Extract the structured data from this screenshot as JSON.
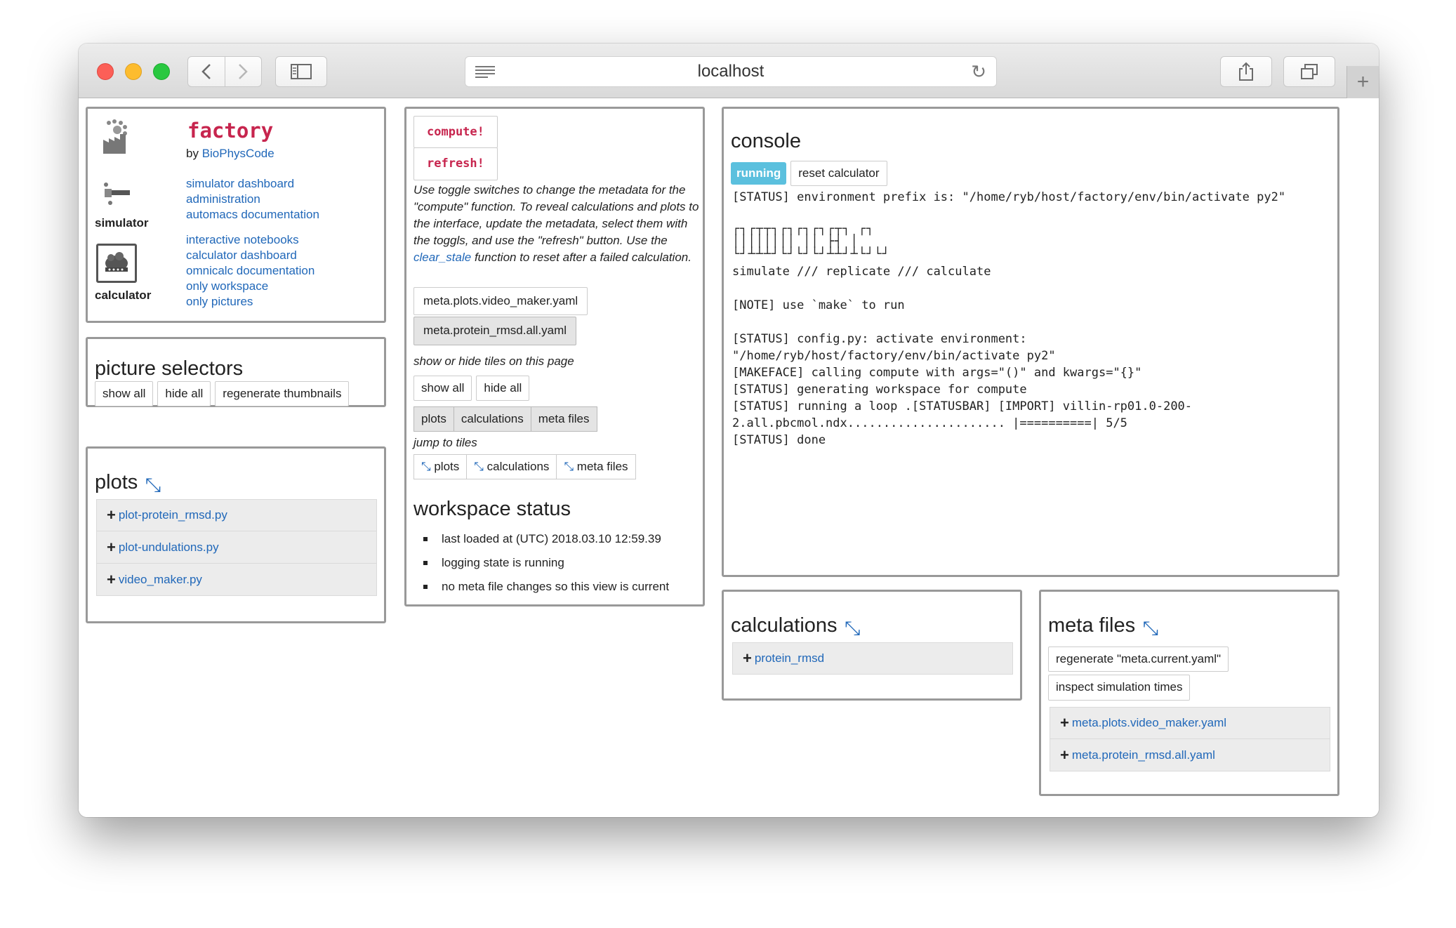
{
  "browser": {
    "url": "localhost",
    "back_icon": "chevron-left-icon",
    "forward_icon": "chevron-right-icon",
    "sidebar_icon": "sidebar-icon",
    "reader_icon": "reader-lines-icon",
    "reload_icon": "reload-icon",
    "share_icon": "share-icon",
    "tabs_icon": "tabs-icon",
    "new_tab_icon": "plus-icon"
  },
  "brand": {
    "name": "factory",
    "by_prefix": "by ",
    "by_link": "BioPhysCode",
    "simulator_label": "simulator",
    "calculator_label": "calculator",
    "simulator_links": [
      "simulator dashboard",
      "administration",
      "automacs documentation"
    ],
    "calculator_links": [
      "interactive notebooks",
      "calculator dashboard",
      "omnicalc documentation",
      "only workspace",
      "only pictures"
    ]
  },
  "picture_selectors": {
    "title": "picture selectors",
    "buttons": [
      "show all",
      "hide all",
      "regenerate thumbnails"
    ]
  },
  "plots": {
    "title": "plots",
    "items": [
      "plot-protein_rmsd.py",
      "plot-undulations.py",
      "video_maker.py"
    ]
  },
  "controls": {
    "compute_label": "compute!",
    "refresh_label": "refresh!",
    "help_part1": "Use toggle switches to change the metadata for the \"compute\" function. To reveal calculations and plots to the interface, update the metadata, select them with the toggls, and use the \"refresh\" button. Use the ",
    "help_link": "clear_stale",
    "help_part2": " function to reset after a failed calculation.",
    "meta_toggles": [
      "meta.plots.video_maker.yaml",
      "meta.protein_rmsd.all.yaml"
    ],
    "show_hide_caption": "show or hide tiles on this page",
    "show_all": "show all",
    "hide_all": "hide all",
    "tile_toggles": [
      "plots",
      "calculations",
      "meta files"
    ],
    "jump_caption": "jump to tiles",
    "jump_buttons": [
      "plots",
      "calculations",
      "meta files"
    ]
  },
  "workspace_status": {
    "title": "workspace status",
    "items": [
      "last loaded at (UTC) 2018.03.10 12:59.39",
      "logging state is running",
      "no meta file changes so this view is current"
    ]
  },
  "console": {
    "title": "console",
    "state_badge": "running",
    "reset_button": "reset calculator",
    "line_env": "[STATUS] environment prefix is: \"/home/ryb/host/factory/env/bin/activate py2\"",
    "banner_row1": "┌┐┌┬┬┐┌┐┌┐┌┐┌┬┐  ┌┐",
    "banner_row2": "││││││││ ││  ├┤  │",
    "banner_row3": "└┘┴┴┴┘└┘└┘└┘┴┴┘┴└┘└┘",
    "tagline": "simulate /// replicate /// calculate",
    "note": "[NOTE] use `make` to run",
    "log": "[STATUS] config.py: activate environment:\n\"/home/ryb/host/factory/env/bin/activate py2\"\n[MAKEFACE] calling compute with args=\"()\" and kwargs=\"{}\"\n[STATUS] generating workspace for compute\n[STATUS] running a loop .[STATUSBAR] [IMPORT] villin-rp01.0-200-\n2.all.pbcmol.ndx...................... |==========| 5/5\n[STATUS] done"
  },
  "calculations": {
    "title": "calculations",
    "items": [
      "protein_rmsd"
    ]
  },
  "meta_files": {
    "title": "meta files",
    "buttons": [
      "regenerate \"meta.current.yaml\"",
      "inspect simulation times"
    ],
    "items": [
      "meta.plots.video_maker.yaml",
      "meta.protein_rmsd.all.yaml"
    ]
  },
  "colors": {
    "accent_link": "#2168b9",
    "code_red": "#c7254e",
    "running_badge": "#5bc0de"
  }
}
